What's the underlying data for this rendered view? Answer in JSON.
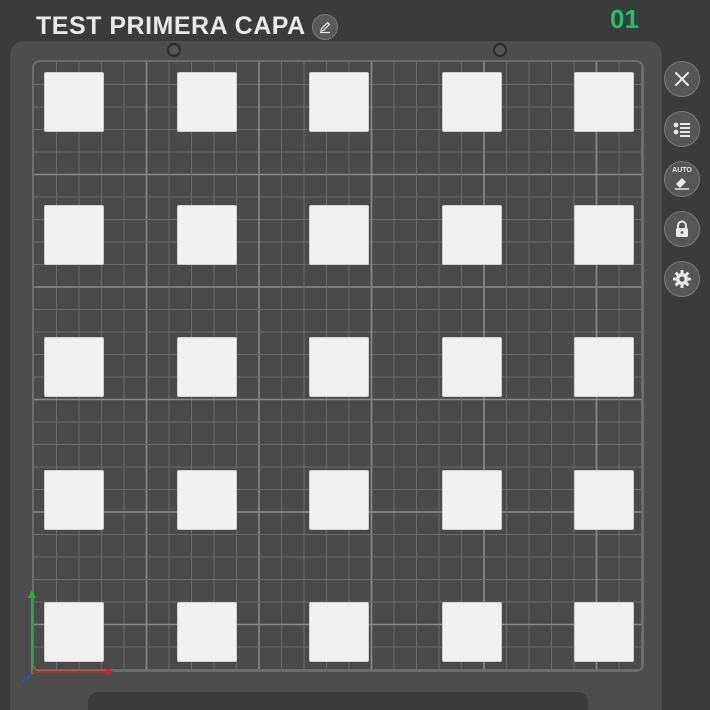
{
  "plate": {
    "title": "TEST PRIMERA CAPA",
    "number": "01",
    "number_color": "#1fc46a"
  },
  "toolbar": {
    "buttons": [
      {
        "name": "close",
        "icon": "close-icon"
      },
      {
        "name": "arrange",
        "icon": "list-icon"
      },
      {
        "name": "auto-orient",
        "icon": "auto-orient-icon",
        "label": "AUTO"
      },
      {
        "name": "lock",
        "icon": "lock-icon"
      },
      {
        "name": "settings",
        "icon": "gear-icon"
      }
    ]
  },
  "objects": {
    "rows": 5,
    "cols": 5,
    "color": "#f1f1f1"
  },
  "axes": {
    "x_color": "#c0252b",
    "y_color": "#2eaa3a",
    "z_color": "#2d4fd8"
  }
}
